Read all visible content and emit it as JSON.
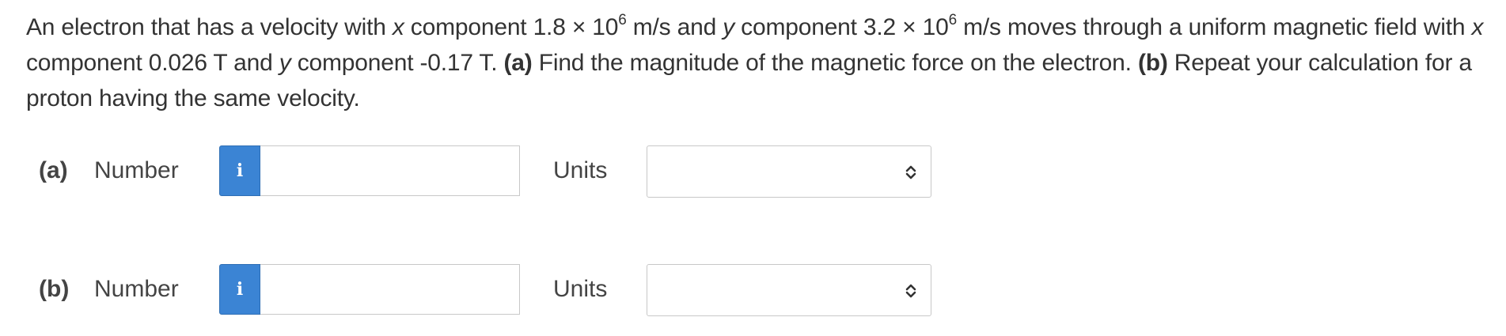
{
  "problem": {
    "text_1": "An electron that has a velocity with ",
    "var_x": "x",
    "text_2": " component 1.8 × 10",
    "exp_1": "6",
    "text_3": " m/s and ",
    "var_y": "y",
    "text_4": " component 3.2 × 10",
    "exp_2": "6",
    "text_5": " m/s moves through a uniform magnetic field with ",
    "var_x2": "x",
    "text_6": " component 0.026 T and ",
    "var_y2": "y",
    "text_7": " component -0.17 T. ",
    "part_a_tag": "(a)",
    "text_8": " Find the magnitude of the magnetic force on the electron. ",
    "part_b_tag": "(b)",
    "text_9": " Repeat your calculation for a proton having the same velocity."
  },
  "answers": [
    {
      "part_label": "(a)",
      "number_label": "Number",
      "info_icon": "i",
      "number_value": "",
      "units_label": "Units",
      "units_value": ""
    },
    {
      "part_label": "(b)",
      "number_label": "Number",
      "info_icon": "i",
      "number_value": "",
      "units_label": "Units",
      "units_value": ""
    }
  ],
  "colors": {
    "info_button": "#3b84d4",
    "text": "#333333",
    "border": "#c8c8c8"
  }
}
